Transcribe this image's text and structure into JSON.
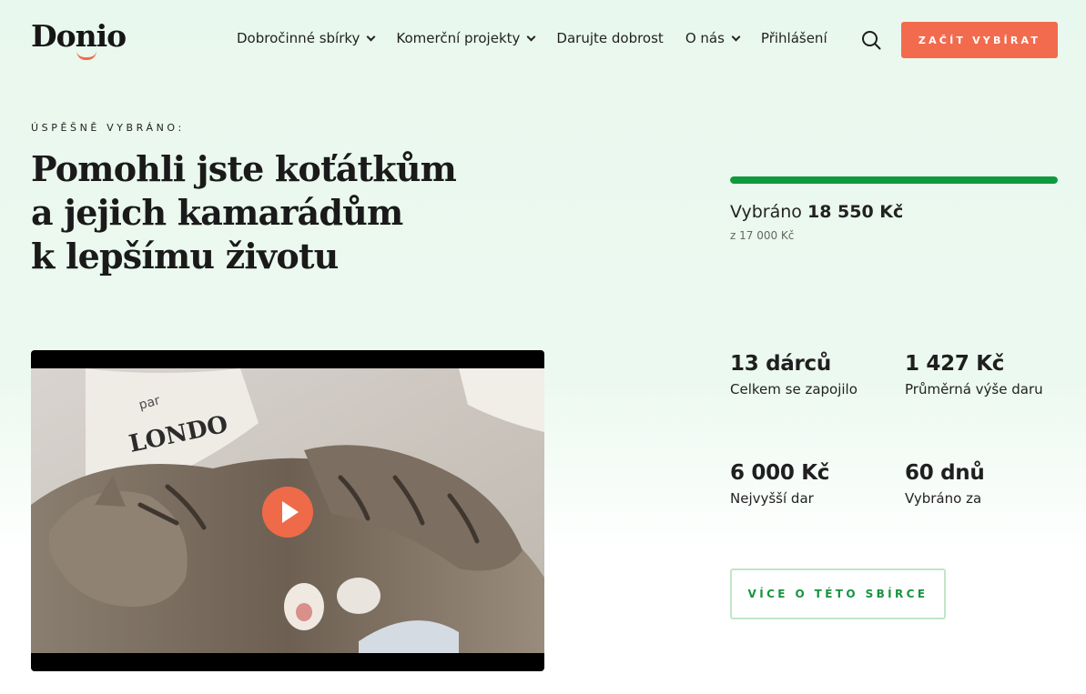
{
  "brand": {
    "name": "Donio",
    "accent": "#f26b4e",
    "success": "#0f9a3c"
  },
  "nav": {
    "items": [
      {
        "label": "Dobročinné sbírky",
        "has_dropdown": true
      },
      {
        "label": "Komerční projekty",
        "has_dropdown": true
      },
      {
        "label": "Darujte dobrost",
        "has_dropdown": false
      },
      {
        "label": "O nás",
        "has_dropdown": true
      },
      {
        "label": "Přihlášení",
        "has_dropdown": false
      }
    ],
    "search_icon": "search-icon",
    "cta_label": "ZAČÍT VYBÍRAT"
  },
  "hero": {
    "eyebrow": "ÚSPĚŠNĚ VYBRÁNO:",
    "title_lines": [
      "Pomohli jste koťátkům",
      "a jejich kamarádům",
      "k lepšímu životu"
    ]
  },
  "progress": {
    "percent": 100,
    "raised_prefix": "Vybráno",
    "raised_amount": "18 550 Kč",
    "goal": "z 17 000 Kč"
  },
  "video": {
    "play_icon": "play-icon"
  },
  "stats": [
    {
      "value": "13 dárců",
      "label": "Celkem se zapojilo"
    },
    {
      "value": "1 427 Kč",
      "label": "Průměrná výše daru"
    },
    {
      "value": "6 000 Kč",
      "label": "Nejvyšší dar"
    },
    {
      "value": "60 dnů",
      "label": "Vybráno za"
    }
  ],
  "more_button": "VÍCE O TÉTO SBÍRCE"
}
